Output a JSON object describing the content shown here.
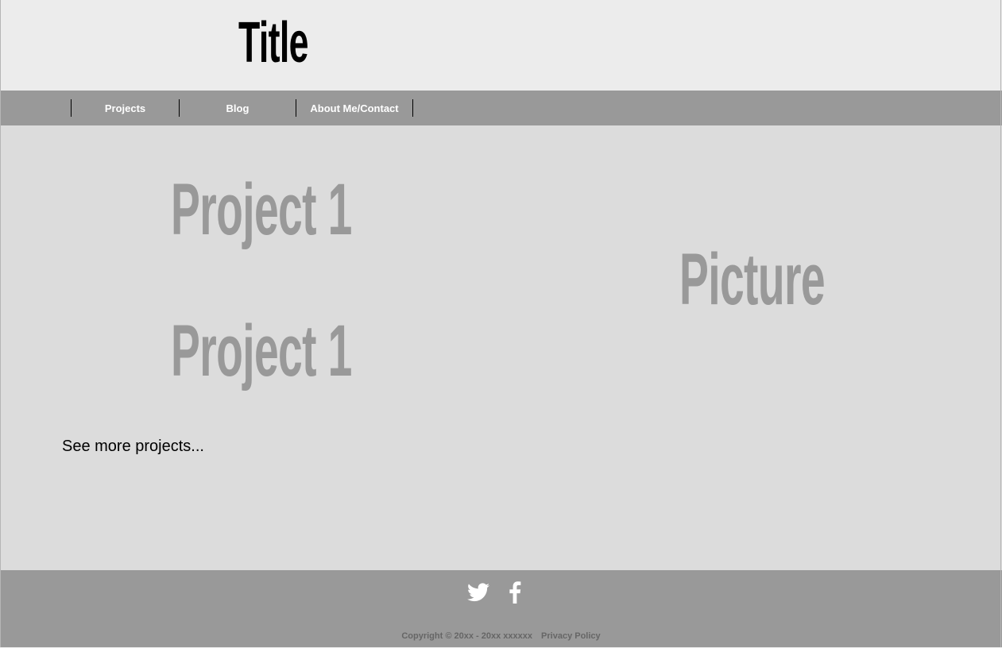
{
  "header": {
    "title": "Title"
  },
  "nav": {
    "items": [
      {
        "label": "Projects"
      },
      {
        "label": "Blog"
      },
      {
        "label": "About Me/Contact"
      }
    ]
  },
  "main": {
    "projects": [
      {
        "title": "Project 1"
      },
      {
        "title": "Project 1"
      }
    ],
    "picture_label": "Picture",
    "see_more": "See more projects..."
  },
  "footer": {
    "social": [
      {
        "icon": "twitter-icon"
      },
      {
        "icon": "facebook-icon"
      }
    ],
    "copyright": "Copyright © 20xx - 20xx xxxxxx",
    "privacy": "Privacy Policy"
  },
  "colors": {
    "header_bg": "#ececec",
    "nav_bg": "#999999",
    "main_bg": "#dcdcdc",
    "muted_text": "#999999",
    "footer_text": "#666666"
  }
}
